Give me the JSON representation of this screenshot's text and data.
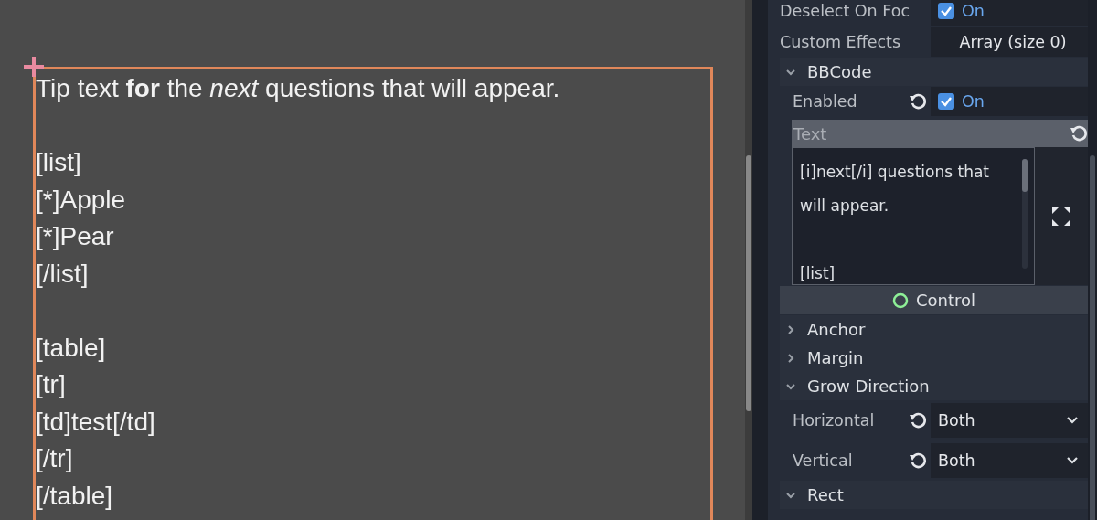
{
  "canvas": {
    "paragraphs": [
      [
        "Tip text **for** the *next* questions that will appear."
      ],
      [
        "[list]",
        "[*]Apple",
        "[*]Pear",
        "[/list]"
      ],
      [
        "[table]",
        "[tr]",
        "[td]test[/td]",
        "[/tr]",
        "[/table]"
      ]
    ]
  },
  "inspector": {
    "items": [
      {
        "kind": "check",
        "label": "Deselect On Foc",
        "modified": false,
        "checked": true,
        "value": "On"
      },
      {
        "kind": "value",
        "label": "Custom Effects",
        "modified": false,
        "value": "Array (size 0)"
      },
      {
        "kind": "section",
        "label": "BBCode",
        "expanded": true,
        "children": [
          {
            "kind": "check",
            "label": "Enabled",
            "modified": true,
            "checked": true,
            "value": "On"
          },
          {
            "kind": "text",
            "label": "Text",
            "modified": true,
            "paragraphs": [
              [
                "[i]next[/i] questions that",
                "will appear."
              ],
              [
                "[list]"
              ]
            ]
          }
        ]
      },
      {
        "kind": "category",
        "label": "Control"
      },
      {
        "kind": "section",
        "label": "Anchor",
        "expanded": false
      },
      {
        "kind": "section",
        "label": "Margin",
        "expanded": false
      },
      {
        "kind": "section",
        "label": "Grow Direction",
        "expanded": true,
        "children": [
          {
            "kind": "enum",
            "label": "Horizontal",
            "modified": true,
            "value": "Both"
          },
          {
            "kind": "enum",
            "label": "Vertical",
            "modified": true,
            "value": "Both"
          }
        ]
      },
      {
        "kind": "section",
        "label": "Rect",
        "expanded": true
      }
    ]
  }
}
